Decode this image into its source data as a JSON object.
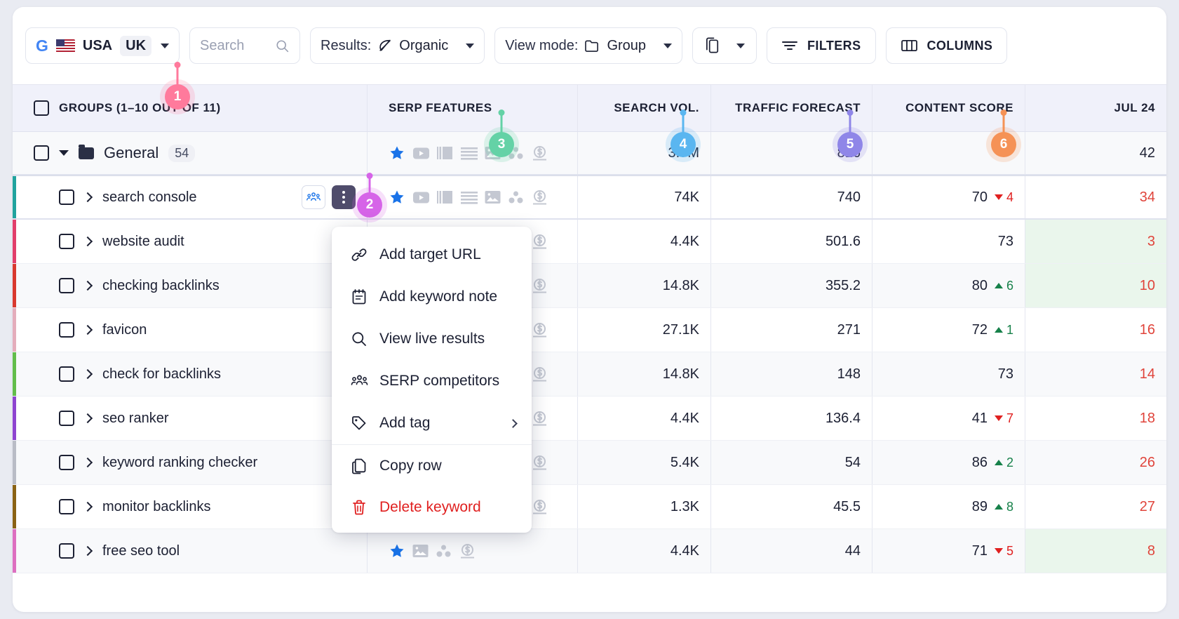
{
  "toolbar": {
    "engine_icon": "google-icon",
    "country_label": "USA",
    "country_flag": "us-flag-icon",
    "region_label": "UK",
    "search_placeholder": "Search",
    "search_icon": "search-icon",
    "results_prefix": "Results:",
    "results_value": "Organic",
    "results_icon": "leaf-icon",
    "viewmode_prefix": "View mode:",
    "viewmode_value": "Group",
    "viewmode_icon": "folder-icon",
    "compare_icon": "compare-devices-icon",
    "filters_label": "FILTERS",
    "filters_icon": "filter-icon",
    "columns_label": "COLUMNS",
    "columns_icon": "columns-icon"
  },
  "table": {
    "headers": {
      "groups": "GROUPS  (1–10 OUT OF 11)",
      "serp": "SERP FEATURES",
      "volume": "SEARCH  VOL.",
      "traffic": "TRAFFIC FORECAST",
      "content": "CONTENT SCORE",
      "date": "JUL 24"
    },
    "group_row": {
      "name": "General",
      "count": "54",
      "serp": [
        "star",
        "video",
        "carousel",
        "text",
        "image",
        "people",
        "money"
      ],
      "volume": "3.7M",
      "traffic": "816",
      "content": "",
      "content_delta": "",
      "date": "42",
      "date_highlight": false
    },
    "rows": [
      {
        "name": "search console",
        "color": "#20a39e",
        "selected": true,
        "serp": [
          "star",
          "video",
          "carousel",
          "text",
          "image",
          "people",
          "money"
        ],
        "volume": "74K",
        "traffic": "740",
        "content": "70",
        "delta": "4",
        "delta_dir": "down",
        "date": "34",
        "date_highlight": false
      },
      {
        "name": "website audit",
        "color": "#e23e6b",
        "selected": false,
        "serp": [
          "star",
          "video",
          "carousel",
          "text",
          "image",
          "people",
          "money"
        ],
        "volume": "4.4K",
        "traffic": "501.6",
        "content": "73",
        "delta": "",
        "delta_dir": "",
        "date": "3",
        "date_highlight": true
      },
      {
        "name": "checking backlinks",
        "color": "#d9382e",
        "selected": false,
        "serp": [
          "star",
          "video",
          "carousel",
          "text",
          "image",
          "people",
          "money"
        ],
        "volume": "14.8K",
        "traffic": "355.2",
        "content": "80",
        "delta": "6",
        "delta_dir": "up",
        "date": "10",
        "date_highlight": true
      },
      {
        "name": "favicon",
        "color": "#e4adbb",
        "selected": false,
        "serp": [
          "star",
          "video",
          "carousel",
          "text",
          "image",
          "people",
          "money"
        ],
        "volume": "27.1K",
        "traffic": "271",
        "content": "72",
        "delta": "1",
        "delta_dir": "up",
        "date": "16",
        "date_highlight": false
      },
      {
        "name": "check for backlinks",
        "color": "#62bd4a",
        "selected": false,
        "serp": [
          "star",
          "video",
          "carousel",
          "text",
          "image",
          "people",
          "money"
        ],
        "volume": "14.8K",
        "traffic": "148",
        "content": "73",
        "delta": "",
        "delta_dir": "",
        "date": "14",
        "date_highlight": false
      },
      {
        "name": "seo ranker",
        "color": "#8e44d0",
        "selected": false,
        "serp": [
          "star",
          "video",
          "carousel",
          "text",
          "image",
          "people",
          "money"
        ],
        "volume": "4.4K",
        "traffic": "136.4",
        "content": "41",
        "delta": "7",
        "delta_dir": "down",
        "date": "18",
        "date_highlight": false
      },
      {
        "name": "keyword ranking checker",
        "color": "#b9bcc6",
        "selected": false,
        "serp": [
          "star",
          "video",
          "carousel",
          "text",
          "image",
          "people",
          "money"
        ],
        "volume": "5.4K",
        "traffic": "54",
        "content": "86",
        "delta": "2",
        "delta_dir": "up",
        "date": "26",
        "date_highlight": false
      },
      {
        "name": "monitor backlinks",
        "color": "#8a6214",
        "selected": false,
        "serp": [
          "star",
          "video",
          "carousel",
          "text",
          "image",
          "people",
          "money"
        ],
        "volume": "1.3K",
        "traffic": "45.5",
        "content": "89",
        "delta": "8",
        "delta_dir": "up",
        "date": "27",
        "date_highlight": false
      },
      {
        "name": "free seo tool",
        "color": "#dd6fc0",
        "selected": false,
        "serp": [
          "star",
          "image",
          "people",
          "money"
        ],
        "volume": "4.4K",
        "traffic": "44",
        "content": "71",
        "delta": "5",
        "delta_dir": "down",
        "date": "8",
        "date_highlight": true
      }
    ]
  },
  "context_menu": {
    "items": [
      {
        "label": "Add target URL",
        "icon": "link-icon"
      },
      {
        "label": "Add keyword note",
        "icon": "note-icon"
      },
      {
        "label": "View live results",
        "icon": "search-icon"
      },
      {
        "label": "SERP competitors",
        "icon": "people-icon"
      },
      {
        "label": "Add tag",
        "icon": "tag-icon",
        "submenu": true
      },
      {
        "label": "Copy row",
        "icon": "copy-icon",
        "separator": true
      },
      {
        "label": "Delete keyword",
        "icon": "trash-icon",
        "danger": true
      }
    ]
  },
  "callouts": [
    {
      "number": "1",
      "color": "#ff7a9c"
    },
    {
      "number": "2",
      "color": "#d664e8"
    },
    {
      "number": "3",
      "color": "#64d2a6"
    },
    {
      "number": "4",
      "color": "#5ab6f0"
    },
    {
      "number": "5",
      "color": "#8f86e8"
    },
    {
      "number": "6",
      "color": "#f59256"
    }
  ],
  "row_actions": {
    "competitors_icon": "serp-competitors-icon",
    "more_icon": "more-vertical-icon"
  }
}
